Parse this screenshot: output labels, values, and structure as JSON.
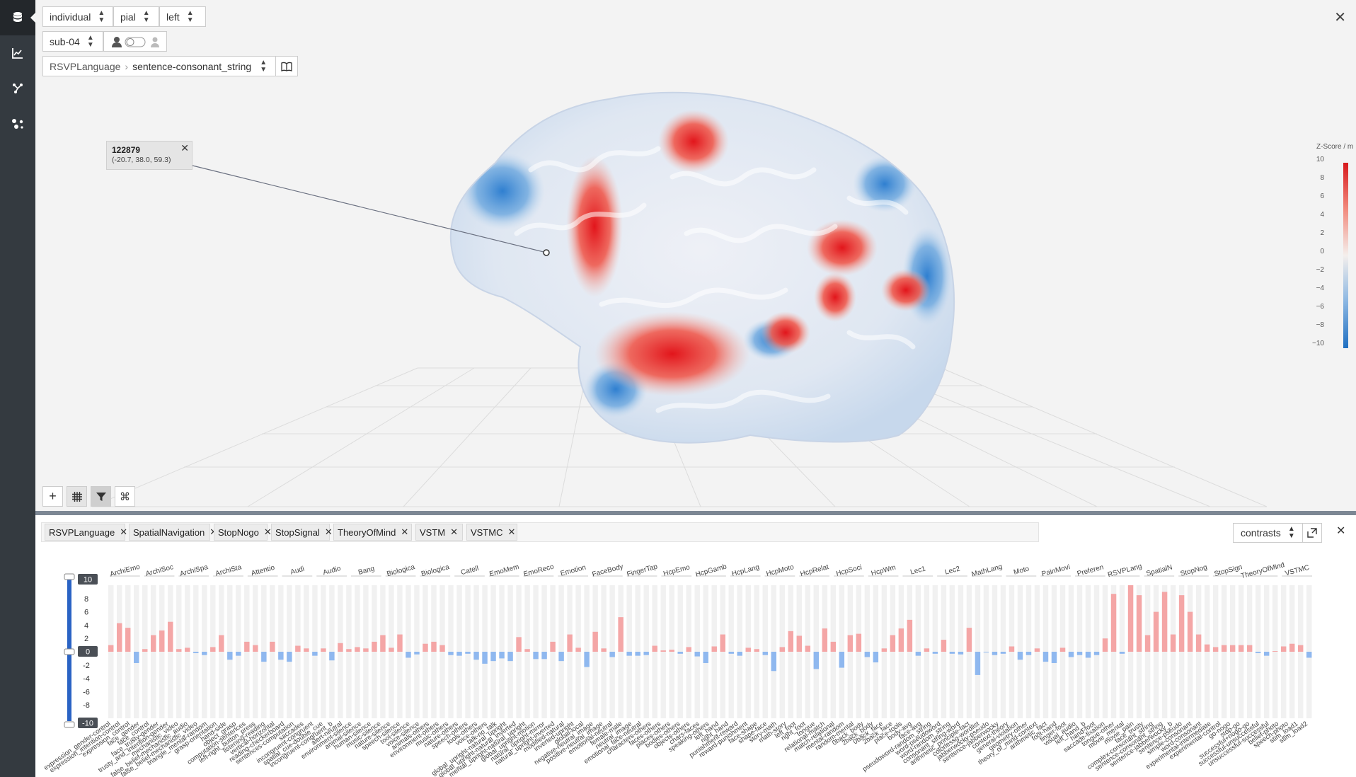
{
  "sidebar": {
    "items": [
      {
        "icon": "database-icon"
      },
      {
        "icon": "chart-icon"
      },
      {
        "icon": "branch-icon"
      },
      {
        "icon": "hub-icon"
      }
    ]
  },
  "viewer": {
    "dataset_select": "individual",
    "surface_select": "pial",
    "hemisphere_select": "left",
    "subject_select": "sub-04",
    "task_breadcrumb": "RSVPLanguage",
    "contrast_select": "sentence-consonant_string",
    "popup": {
      "vertex_id": "122879",
      "coords": "(-20.7, 38.0, 59.3)"
    },
    "colorbar": {
      "title": "Z-Score / m",
      "ticks": [
        "10",
        "8",
        "6",
        "4",
        "2",
        "0",
        "−2",
        "−4",
        "−6",
        "−8",
        "−10"
      ]
    }
  },
  "bottom": {
    "tags": [
      "RSVPLanguage",
      "SpatialNavigation",
      "StopNogo",
      "StopSignal",
      "TheoryOfMind",
      "VSTM",
      "VSTMC"
    ],
    "mode_select": "contrasts",
    "slider": {
      "max_label": "10",
      "zero_label": "0",
      "min_label": "-10",
      "value_max": 10,
      "value_min": -10
    }
  },
  "colors": {
    "positive_bar": "#f4a6a6",
    "negative_bar": "#8fb8ef",
    "bg_bar": "#f1f1f1",
    "slider": "#2a63c4"
  },
  "chart_data": {
    "type": "bar",
    "ylim": [
      -10,
      10
    ],
    "yticks": [
      8,
      6,
      4,
      2,
      0,
      -2,
      -4,
      -6,
      -8
    ],
    "groups": [
      "ArchiEmo",
      "ArchiSoc",
      "ArchiSpa",
      "ArchiSta",
      "Attentio",
      "Audi",
      "Audio",
      "Bang",
      "Biologica",
      "Biologica",
      "Catell",
      "EmoMem",
      "EmoReco",
      "Emotion",
      "FaceBody",
      "FingerTap",
      "HcpEmo",
      "HcpGamb",
      "HcpLang",
      "HcpMoto",
      "HcpRelat",
      "HcpSoci",
      "HcpWm",
      "Lec1",
      "Lec2",
      "MathLang",
      "Moto",
      "PainMovi",
      "Preferen",
      "RSVPLang",
      "SpatialN",
      "StopNog",
      "StopSign",
      "TheoryOfMind",
      "VSTMC"
    ],
    "categories": [
      "expression_gender-control",
      "expression_intention-control",
      "expression_control",
      "face_gender",
      "face_control",
      "face_trusty-gender",
      "trusty_and_intention-gender",
      "mechanistic_video",
      "false_belief-mechanistic_audio",
      "false_belief-mechanistic_video",
      "triangle_mental-random",
      "grasp-orientation",
      "hand-side",
      "object_grasp",
      "computation-sentences",
      "left-right_button_press",
      "listening-reading",
      "vertical-horizontal",
      "reading-checkerboard",
      "sentences-computation",
      "saccades",
      "incongruent-congruent",
      "spatial_cue-double_cue",
      "incongruent-congruent_b",
      "alert-neutral",
      "environment-silence",
      "animal-silence",
      "human-silence",
      "music-silence",
      "nature-silence",
      "speech-silence",
      "tool-silence",
      "voice-silence",
      "animals-others",
      "environment-others",
      "music-others",
      "nature-others",
      "speech-others",
      "tools-others",
      "voice-others",
      "talk-no_talk",
      "global_upright-natural_upright",
      "global_upright-natural_inverted",
      "mental_upright-natural_upright",
      "global_upright-motion",
      "natural_upright-mirror",
      "natural_upright-inverted",
      "modified-natural",
      "inverted-upright",
      "global-local",
      "negative-neutral_image",
      "positive-neutral_image",
      "emotional-neutral",
      "female-male",
      "neutral_image",
      "emotional_face-neutral",
      "characters-others",
      "faces-others",
      "places-others",
      "bodies-others",
      "objects-others",
      "chars-faces",
      "speaking-others",
      "left_hand",
      "right_hand",
      "punishment-reward",
      "reward-punishment",
      "face-shape",
      "shape-face",
      "story-math",
      "math-story",
      "left_foot",
      "right_foot",
      "tongue",
      "relational-match",
      "match-relational",
      "mental-random",
      "random-mental",
      "0back_body",
      "2back_body",
      "0back_face",
      "2back_face",
      "place-tools",
      "body-avg",
      "face-avg",
      "pseudoword-random_string",
      "word-pseudoword",
      "word-random_string",
      "consonant_string-word",
      "arithmetic_principle-fact",
      "colorlessg-wordlist",
      "jabberwocky-pseudo",
      "sentence-jabberwocky",
      "context-theory",
      "general-violation",
      "geometry-other",
      "theory_of_mind-context",
      "arithmetic_fact",
      "foot-hand",
      "finger-foot",
      "visual_audio",
      "left_hand_b",
      "hand-foot",
      "saccade-fixation",
      "tongue-other",
      "movie_mental",
      "movie_pain",
      "face_trusty",
      "complex-consonant_string",
      "sentence-consonant_string",
      "sentence-jabberwocky_b",
      "sentence-pseudo",
      "simple-consonant",
      "word-consonant",
      "experimental-intermediate",
      "experimental-control",
      "go-nogo",
      "stop-go",
      "successful+nogo-go",
      "successful-unsuccessful",
      "unsuccessful-successful",
      "belief-photo",
      "speech-photo",
      "stim_load1",
      "stim_load2"
    ],
    "values": [
      1.0,
      4.3,
      3.6,
      -1.7,
      0.4,
      2.5,
      3.2,
      4.5,
      0.4,
      0.6,
      -0.2,
      -0.5,
      0.7,
      2.5,
      -1.2,
      -0.6,
      1.5,
      1.0,
      -1.5,
      1.5,
      -1.2,
      -1.5,
      0.9,
      0.5,
      -0.6,
      0.5,
      -1.3,
      1.3,
      0.4,
      0.7,
      0.5,
      1.5,
      2.5,
      0.6,
      2.6,
      -0.9,
      -0.4,
      1.2,
      1.5,
      1.0,
      -0.5,
      -0.6,
      -0.3,
      -1.2,
      -1.8,
      -1.4,
      -1.0,
      -1.4,
      2.2,
      0.4,
      -1.1,
      -1.1,
      1.5,
      -1.4,
      2.6,
      0.6,
      -2.3,
      3.0,
      0.5,
      -0.8,
      5.2,
      -0.6,
      -0.6,
      -0.5,
      0.9,
      0.2,
      0.3,
      -0.3,
      0.7,
      -0.7,
      -1.7,
      0.8,
      2.6,
      -0.3,
      -0.6,
      0.6,
      0.4,
      -0.5,
      -2.9,
      0.7,
      3.1,
      2.4,
      0.9,
      -2.6,
      3.5,
      1.5,
      -2.4,
      2.5,
      2.7,
      -0.8,
      -1.6,
      0.5,
      2.5,
      3.5,
      4.8,
      -0.6,
      0.5,
      -0.3,
      1.8,
      -0.3,
      -0.4,
      3.6,
      -3.5,
      -0.1,
      -0.5,
      -0.3,
      0.8,
      -1.2,
      -0.5,
      0.5,
      -1.5,
      -1.7,
      0.6,
      -0.8,
      -0.5,
      -0.9,
      -0.5,
      2.0,
      8.7,
      -0.3,
      10.0,
      8.5,
      2.5,
      6.0,
      9.0,
      2.6,
      8.5,
      6.0,
      2.6,
      1.1,
      0.7,
      1.0,
      1.0,
      1.0,
      1.0,
      -0.2,
      -0.6,
      0.1,
      0.8,
      1.2,
      1.0,
      -0.9
    ]
  }
}
